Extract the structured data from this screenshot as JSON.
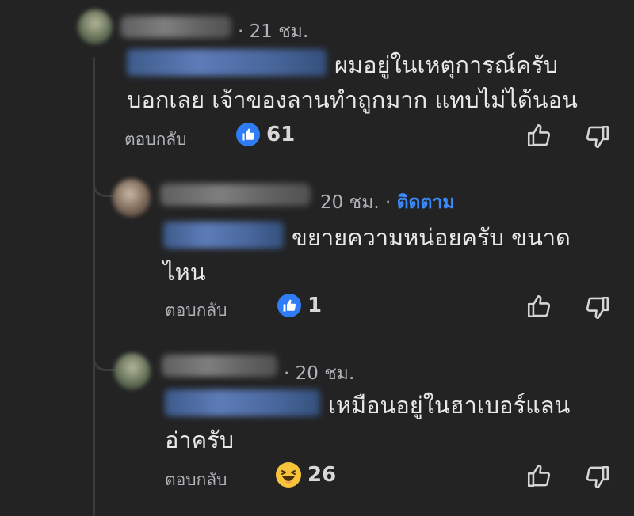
{
  "colors": {
    "background": "#232324",
    "link": "#3b8bff",
    "like": "#2e7df6",
    "haha": "#f7c33b",
    "muted": "#b0b3b8"
  },
  "comments": [
    {
      "time": "· 21 ชม.",
      "text": "ผมอยู่ในเหตุการณ์ครับ\nบอกเลย เจ้าของลานทำถูกมาก แทบไม่ได้นอน",
      "reply_label": "ตอบกลับ",
      "reaction_icon": "like-icon",
      "reaction_count": "61"
    },
    {
      "time": "20 ชม. ·",
      "follow_label": "ติดตาม",
      "text": "ขยายความหน่อยครับ ขนาด\nไหน",
      "reply_label": "ตอบกลับ",
      "reaction_icon": "like-icon",
      "reaction_count": "1"
    },
    {
      "time": "· 20 ชม.",
      "text": "เหมือนอยู่ในฮาเบอร์แลน\nอ่าครับ",
      "reply_label": "ตอบกลับ",
      "reaction_icon": "haha-icon",
      "reaction_count": "26"
    }
  ]
}
